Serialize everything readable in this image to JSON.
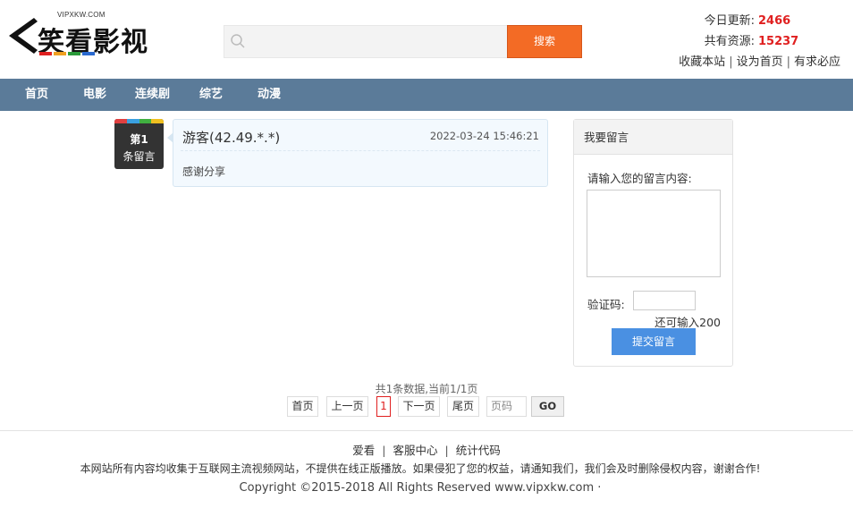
{
  "header": {
    "logo_small": "VIPXKW.COM",
    "logo_text": "笑看影视",
    "search_placeholder": "",
    "search_button": "搜索",
    "today_update_label": "今日更新:",
    "today_update_value": "2466",
    "total_resources_label": "共有资源:",
    "total_resources_value": "15237",
    "links": [
      "收藏本站",
      "设为首页",
      "有求必应"
    ]
  },
  "nav": {
    "items": [
      "首页",
      "电影",
      "连续剧",
      "综艺",
      "动漫"
    ]
  },
  "comment": {
    "badge_num": "第1",
    "badge_label": "条留言",
    "user": "游客(42.49.*.*)",
    "time": "2022-03-24 15:46:21",
    "text": "感谢分享"
  },
  "form": {
    "title": "我要留言",
    "prompt": "请输入您的留言内容:",
    "captcha_label": "验证码:",
    "remaining": "还可输入200",
    "submit": "提交留言"
  },
  "pagination": {
    "info": "共1条数据,当前1/1页",
    "first": "首页",
    "prev": "上一页",
    "current": "1",
    "next": "下一页",
    "last": "尾页",
    "page_input_placeholder": "页码",
    "go": "GO"
  },
  "footer": {
    "links": [
      "爱看",
      "客服中心",
      "统计代码"
    ],
    "disclaimer": "本网站所有内容均收集于互联网主流视频网站，不提供在线正版播放。如果侵犯了您的权益，请通知我们，我们会及时删除侵权内容，谢谢合作!",
    "copyright": "Copyright ©2015-2018 All Rights Reserved www.vipxkw.com ·"
  },
  "colors": {
    "nav_bg": "#5b7b99",
    "search_button": "#f36b25",
    "stat_number": "#e02020",
    "submit_button": "#4a90e2"
  }
}
